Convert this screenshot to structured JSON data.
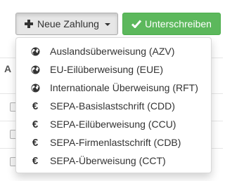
{
  "toolbar": {
    "new_payment_label": "Neue Zahlung",
    "sign_label": "Unterschreiben"
  },
  "table_hint": {
    "header_letter": "A"
  },
  "menu": {
    "items": [
      {
        "label": "Auslandsüberweisung (AZV)",
        "icon": "globe-icon",
        "glyph": ""
      },
      {
        "label": "EU-Eilüberweisung (EUE)",
        "icon": "globe-icon",
        "glyph": ""
      },
      {
        "label": "Internationale Überweisung (RFT)",
        "icon": "globe-icon",
        "glyph": ""
      },
      {
        "label": "SEPA-Basislastschrift (CDD)",
        "icon": "euro-icon",
        "glyph": "€"
      },
      {
        "label": "SEPA-Eilüberweisung (CCU)",
        "icon": "euro-icon",
        "glyph": "€"
      },
      {
        "label": "SEPA-Firmenlastschrift (CDB)",
        "icon": "euro-icon",
        "glyph": "€"
      },
      {
        "label": "SEPA-Überweisung (CCT)",
        "icon": "euro-icon",
        "glyph": "€"
      }
    ]
  },
  "colors": {
    "success": "#5cb85c",
    "default_active": "#e6e6e6",
    "text": "#333333"
  }
}
